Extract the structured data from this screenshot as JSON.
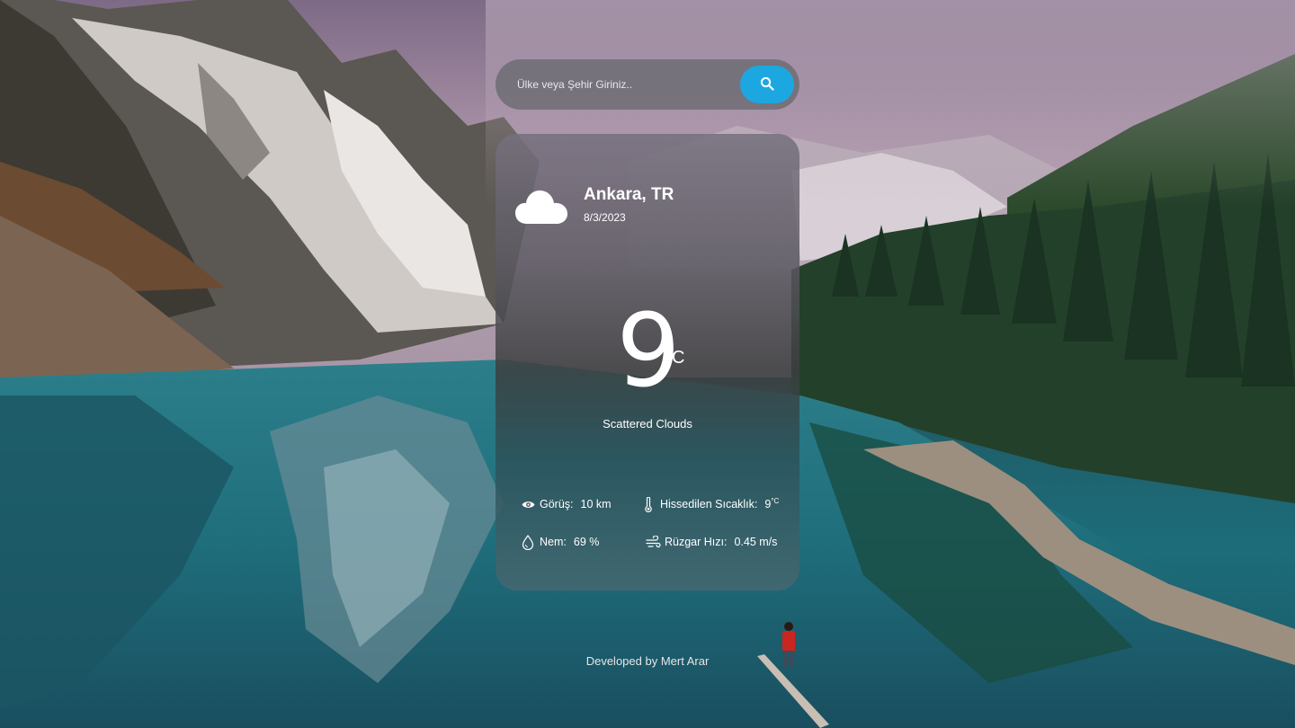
{
  "search": {
    "placeholder": "Ülke veya Şehir Giriniz..",
    "icon": "search-icon",
    "button_color": "#1da7e0"
  },
  "weather": {
    "icon": "cloud-icon",
    "city": "Ankara, TR",
    "date": "8/3/2023",
    "temperature": "9",
    "unit": "°C",
    "description": "Scattered Clouds"
  },
  "details": {
    "visibility": {
      "icon": "eye-icon",
      "label": "Görüş:",
      "value": "10 km"
    },
    "feels_like": {
      "icon": "thermometer-icon",
      "label": "Hissedilen Sıcaklık:",
      "value": "9",
      "unit": "°C"
    },
    "humidity": {
      "icon": "droplet-icon",
      "label": "Nem:",
      "value": "69 %"
    },
    "wind": {
      "icon": "wind-icon",
      "label": "Rüzgar Hızı:",
      "value": "0.45 m/s"
    }
  },
  "footer": {
    "credit": "Developed by Mert Arar"
  }
}
